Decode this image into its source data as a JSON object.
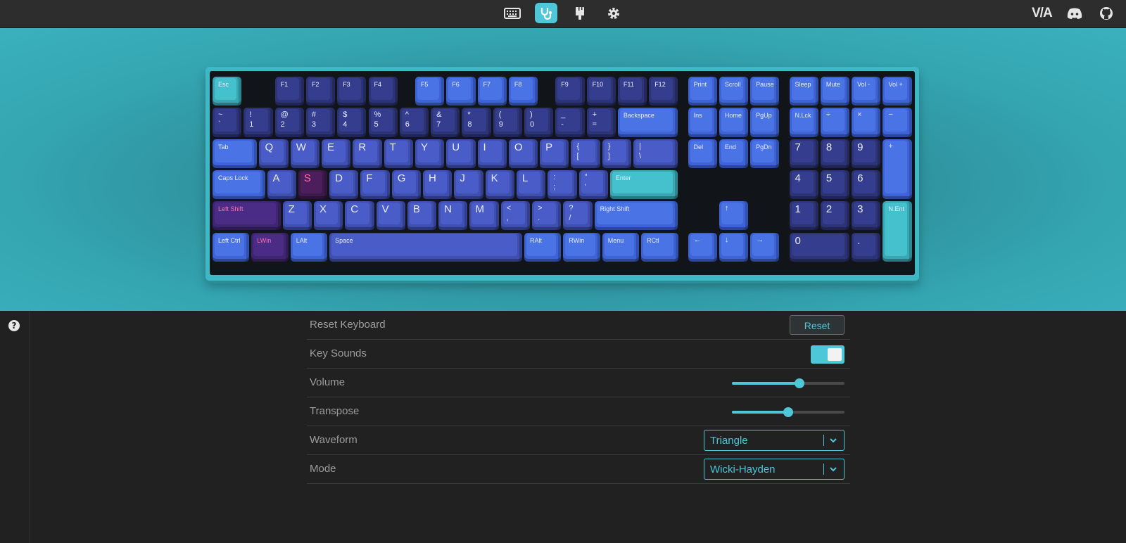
{
  "topbar": {
    "tabs": [
      {
        "name": "keyboard-icon",
        "active": false
      },
      {
        "name": "stethoscope-icon",
        "active": true
      },
      {
        "name": "paint-brush-icon",
        "active": false
      },
      {
        "name": "gear-icon",
        "active": false
      }
    ],
    "brand": "V/A"
  },
  "colors": {
    "accent": "#4ec7d9",
    "background": "#212121",
    "topbar": "#2d2d2d",
    "keycap_blue": "#4a5cc7",
    "keycap_teal": "#45c1cd",
    "keycap_purple": "#4a2c86",
    "highlight_pink": "#ff6fa8"
  },
  "keyboard": {
    "keys": {
      "esc": "Esc",
      "f1": "F1",
      "f2": "F2",
      "f3": "F3",
      "f4": "F4",
      "f5": "F5",
      "f6": "F6",
      "f7": "F7",
      "f8": "F8",
      "f9": "F9",
      "f10": "F10",
      "f11": "F11",
      "f12": "F12",
      "print": "Print",
      "scroll": "Scroll",
      "pause": "Pause",
      "sleep": "Sleep",
      "mute": "Mute",
      "voldown": "Vol -",
      "volup": "Vol +",
      "grave": "~\n`",
      "n1": "!\n1",
      "n2": "@\n2",
      "n3": "#\n3",
      "n4": "$\n4",
      "n5": "%\n5",
      "n6": "^\n6",
      "n7": "&\n7",
      "n8": "*\n8",
      "n9": "(\n9",
      "n0": ")\n0",
      "minus": "_\n-",
      "equal": "+\n=",
      "backspace": "Backspace",
      "ins": "Ins",
      "home": "Home",
      "pgup": "PgUp",
      "nlck": "N.Lck",
      "kpdiv": "÷",
      "kpmul": "×",
      "kpminus": "−",
      "tab": "Tab",
      "q": "Q",
      "w": "W",
      "e": "E",
      "r": "R",
      "t": "T",
      "y": "Y",
      "u": "U",
      "i": "I",
      "o": "O",
      "p": "P",
      "lbrace": "{\n[",
      "rbrace": "}\n]",
      "bslash": "|\n\\",
      "del": "Del",
      "end": "End",
      "pgdn": "PgDn",
      "kp7": "7",
      "kp8": "8",
      "kp9": "9",
      "kpplus": "+",
      "caps": "Caps Lock",
      "a": "A",
      "s": "S",
      "d": "D",
      "f": "F",
      "g": "G",
      "h": "H",
      "j": "J",
      "k": "K",
      "l": "L",
      "semi": ":\n;",
      "quote": "\"\n'",
      "enter": "Enter",
      "kp4": "4",
      "kp5": "5",
      "kp6": "6",
      "lshift": "Left Shift",
      "z": "Z",
      "x": "X",
      "c": "C",
      "v": "V",
      "b": "B",
      "n": "N",
      "m": "M",
      "comma": "<\n,",
      "period": ">\n.",
      "slash": "?\n/",
      "rshift": "Right Shift",
      "up": "↑",
      "kp1": "1",
      "kp2": "2",
      "kp3": "3",
      "kpenter": "N.Ent",
      "lctrl": "Left Ctrl",
      "lwin": "LWin",
      "lalt": "LAlt",
      "space": "Space",
      "ralt": "RAlt",
      "rwin": "RWin",
      "menu": "Menu",
      "rctl": "RCtl",
      "left": "←",
      "down": "↓",
      "right": "→",
      "kp0": "0",
      "kpdot": "."
    }
  },
  "settings": {
    "reset_label": "Reset Keyboard",
    "reset_button": "Reset",
    "key_sounds_label": "Key Sounds",
    "key_sounds_on": true,
    "volume_label": "Volume",
    "volume_value": 0.6,
    "transpose_label": "Transpose",
    "transpose_value": 0.5,
    "waveform_label": "Waveform",
    "waveform_value": "Triangle",
    "mode_label": "Mode",
    "mode_value": "Wicki-Hayden"
  },
  "help_icon": "?"
}
